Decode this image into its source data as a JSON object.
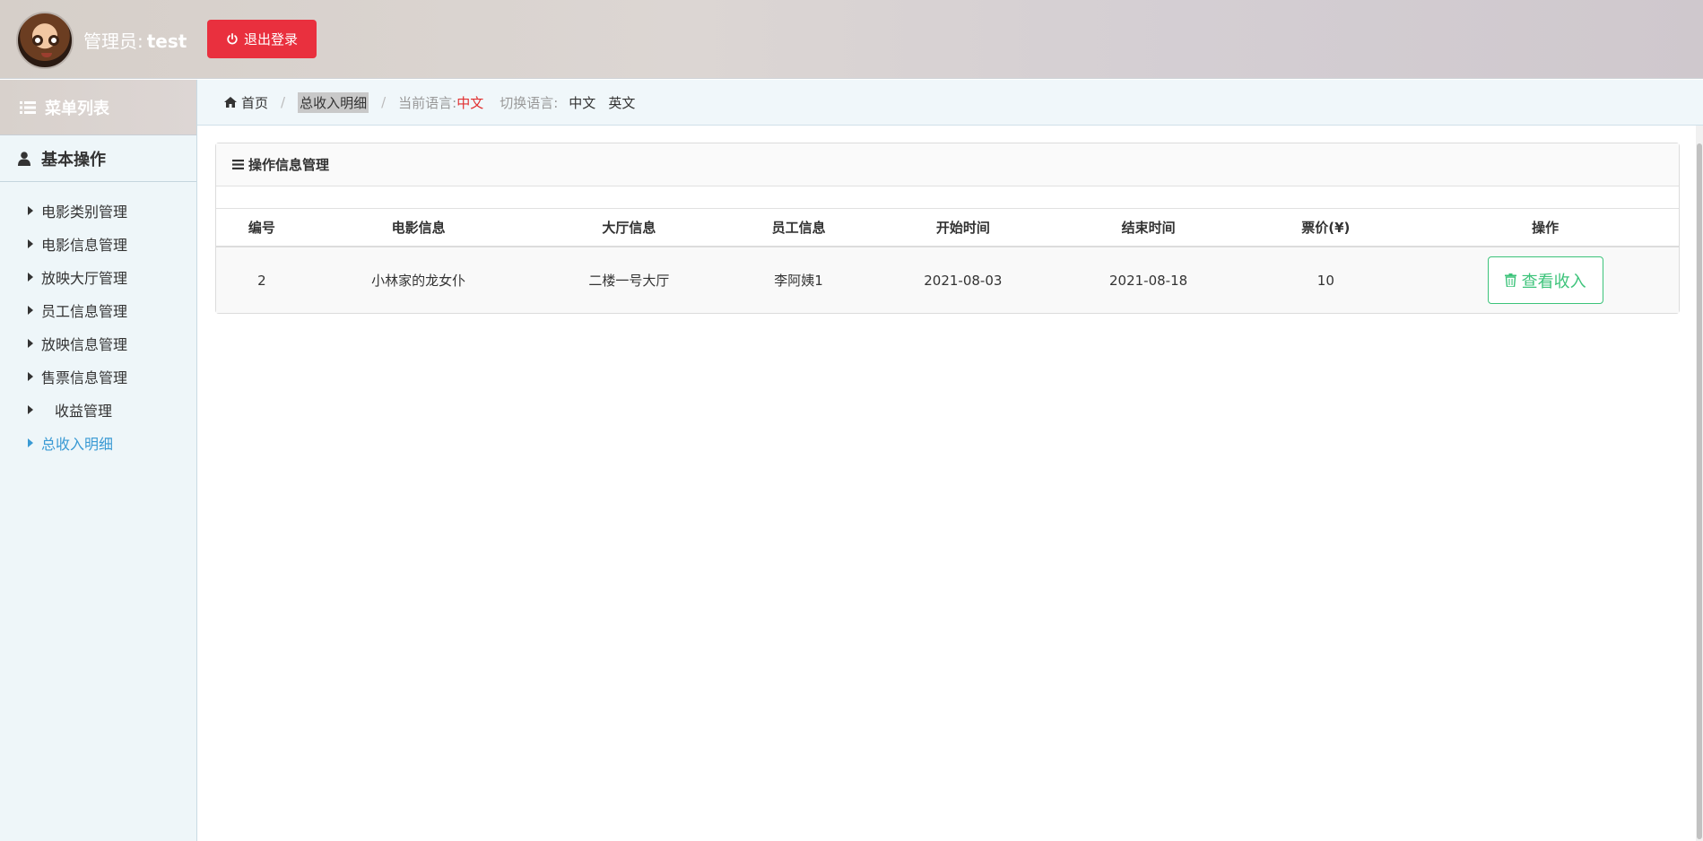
{
  "header": {
    "admin_label": "管理员:",
    "admin_name": "test",
    "logout_label": "退出登录",
    "logout_color": "#e9303e"
  },
  "sidebar": {
    "title": "菜单列表",
    "group_title": "基本操作",
    "items": [
      {
        "label": "电影类别管理"
      },
      {
        "label": "电影信息管理"
      },
      {
        "label": "放映大厅管理"
      },
      {
        "label": "员工信息管理"
      },
      {
        "label": "放映信息管理"
      },
      {
        "label": "售票信息管理"
      },
      {
        "label": "收益管理"
      },
      {
        "label": "总收入明细",
        "active": true
      }
    ]
  },
  "breadcrumb": {
    "home": "首页",
    "current": "总收入明细",
    "lang_current_label": "当前语言:",
    "lang_current_value": "中文",
    "lang_switch_label": "切换语言:",
    "lang_options": [
      "中文",
      "英文"
    ]
  },
  "panel": {
    "title": "操作信息管理",
    "columns": [
      "编号",
      "电影信息",
      "大厅信息",
      "员工信息",
      "开始时间",
      "结束时间",
      "票价(¥)",
      "操作"
    ],
    "rows": [
      {
        "id": "2",
        "movie": "小林家的龙女仆",
        "hall": "二楼一号大厅",
        "staff": "李阿姨1",
        "start": "2021-08-03",
        "end": "2021-08-18",
        "price": "10",
        "action_label": "查看收入"
      }
    ]
  },
  "colors": {
    "accent": "#3a9ad4",
    "success": "#3cc37a",
    "danger": "#e12f2f"
  }
}
